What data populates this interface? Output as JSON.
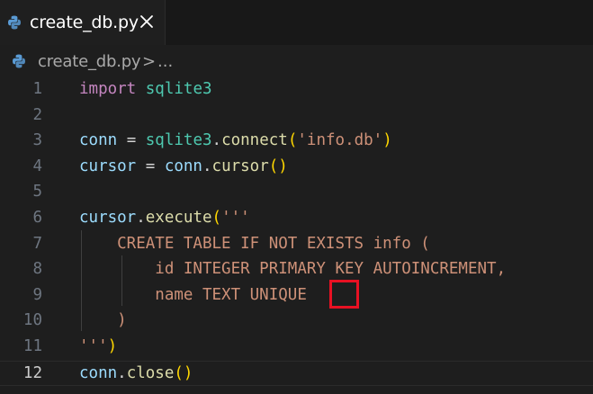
{
  "tab": {
    "filename": "create_db.py",
    "file_icon": "python-icon",
    "close_icon": "close-icon"
  },
  "breadcrumb": {
    "filename": "create_db.py",
    "separator": ">",
    "more": "..."
  },
  "editor": {
    "current_line": 12,
    "lines": [
      {
        "n": "1",
        "tokens": [
          {
            "t": "import",
            "c": "kw"
          },
          {
            "t": " ",
            "c": "op"
          },
          {
            "t": "sqlite3",
            "c": "mod"
          }
        ]
      },
      {
        "n": "2",
        "tokens": []
      },
      {
        "n": "3",
        "tokens": [
          {
            "t": "conn",
            "c": "var"
          },
          {
            "t": " = ",
            "c": "op"
          },
          {
            "t": "sqlite3",
            "c": "mod"
          },
          {
            "t": ".",
            "c": "op"
          },
          {
            "t": "connect",
            "c": "fn"
          },
          {
            "t": "(",
            "c": "p1"
          },
          {
            "t": "'info.db'",
            "c": "str"
          },
          {
            "t": ")",
            "c": "p1"
          }
        ]
      },
      {
        "n": "4",
        "tokens": [
          {
            "t": "cursor",
            "c": "var"
          },
          {
            "t": " = ",
            "c": "op"
          },
          {
            "t": "conn",
            "c": "var"
          },
          {
            "t": ".",
            "c": "op"
          },
          {
            "t": "cursor",
            "c": "fn"
          },
          {
            "t": "()",
            "c": "p1"
          }
        ]
      },
      {
        "n": "5",
        "tokens": []
      },
      {
        "n": "6",
        "tokens": [
          {
            "t": "cursor",
            "c": "var"
          },
          {
            "t": ".",
            "c": "op"
          },
          {
            "t": "execute",
            "c": "fn"
          },
          {
            "t": "(",
            "c": "p1"
          },
          {
            "t": "'''",
            "c": "str"
          }
        ]
      },
      {
        "n": "7",
        "tokens": [
          {
            "t": "    CREATE TABLE IF NOT EXISTS info (",
            "c": "str"
          }
        ]
      },
      {
        "n": "8",
        "tokens": [
          {
            "t": "        id INTEGER PRIMARY KEY AUTOINCREMENT,",
            "c": "str"
          }
        ]
      },
      {
        "n": "9",
        "tokens": [
          {
            "t": "        name TEXT UNIQUE",
            "c": "str"
          }
        ]
      },
      {
        "n": "10",
        "tokens": [
          {
            "t": "    )",
            "c": "str"
          }
        ]
      },
      {
        "n": "11",
        "tokens": [
          {
            "t": "'''",
            "c": "str"
          },
          {
            "t": ")",
            "c": "p1"
          }
        ]
      },
      {
        "n": "12",
        "tokens": [
          {
            "t": "conn",
            "c": "var"
          },
          {
            "t": ".",
            "c": "op"
          },
          {
            "t": "close",
            "c": "fn"
          },
          {
            "t": "()",
            "c": "p1"
          }
        ]
      }
    ]
  },
  "annotation": {
    "color": "#e81123"
  },
  "colors": {
    "editor_bg": "#1e1e1e",
    "tabbar_bg": "#181818",
    "keyword": "#c586c0",
    "module": "#4ec9b0",
    "variable": "#9cdcfe",
    "function": "#dcdcaa",
    "string": "#ce9178",
    "bracket": "#ffd700"
  }
}
